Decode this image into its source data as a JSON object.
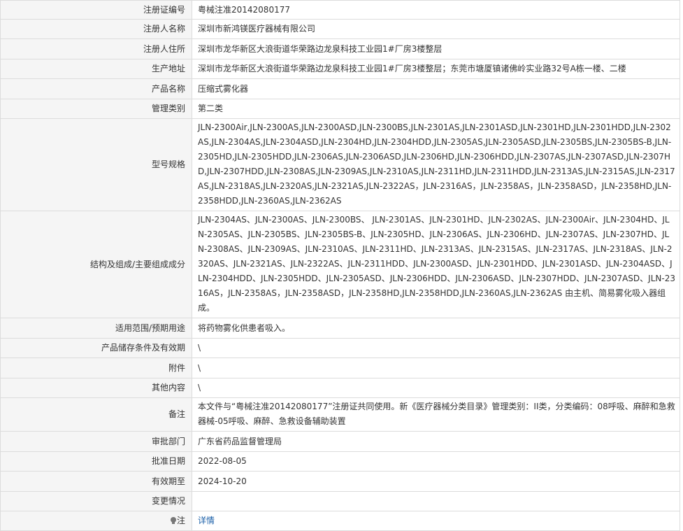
{
  "rows": [
    {
      "label": "注册证编号",
      "value": "粤械注准20142080177"
    },
    {
      "label": "注册人名称",
      "value": "深圳市新鸿镁医疗器械有限公司"
    },
    {
      "label": "注册人住所",
      "value": "深圳市龙华新区大浪街道华荣路边龙泉科技工业园1#厂房3楼整层"
    },
    {
      "label": "生产地址",
      "value": "深圳市龙华新区大浪街道华荣路边龙泉科技工业园1#厂房3楼整层；东莞市塘厦镇诸佛岭实业路32号A栋一楼、二楼"
    },
    {
      "label": "产品名称",
      "value": "压缩式雾化器"
    },
    {
      "label": "管理类别",
      "value": "第二类"
    },
    {
      "label": "型号规格",
      "value": "JLN-2300Air,JLN-2300AS,JLN-2300ASD,JLN-2300BS,JLN-2301AS,JLN-2301ASD,JLN-2301HD,JLN-2301HDD,JLN-2302AS,JLN-2304AS,JLN-2304ASD,JLN-2304HD,JLN-2304HDD,JLN-2305AS,JLN-2305ASD,JLN-2305BS,JLN-2305BS-B,JLN-2305HD,JLN-2305HDD,JLN-2306AS,JLN-2306ASD,JLN-2306HD,JLN-2306HDD,JLN-2307AS,JLN-2307ASD,JLN-2307HD,JLN-2307HDD,JLN-2308AS,JLN-2309AS,JLN-2310AS,JLN-2311HD,JLN-2311HDD,JLN-2313AS,JLN-2315AS,JLN-2317AS,JLN-2318AS,JLN-2320AS,JLN-2321AS,JLN-2322AS，JLN-2316AS，JLN-2358AS，JLN-2358ASD，JLN-2358HD,JLN-2358HDD,JLN-2360AS,JLN-2362AS"
    },
    {
      "label": "结构及组成/主要组成成分",
      "value": "JLN-2304AS、JLN-2300AS、JLN-2300BS、 JLN-2301AS、JLN-2301HD、JLN-2302AS、JLN-2300Air、JLN-2304HD、JLN-2305AS、JLN-2305BS、JLN-2305BS-B、JLN-2305HD、JLN-2306AS、JLN-2306HD、JLN-2307AS、JLN-2307HD、JLN-2308AS、JLN-2309AS、JLN-2310AS、JLN-2311HD、JLN-2313AS、JLN-2315AS、JLN-2317AS、JLN-2318AS、JLN-2320AS、JLN-2321AS、JLN-2322AS、JLN-2311HDD、JLN-2300ASD、JLN-2301HDD、JLN-2301ASD、JLN-2304ASD、JLN-2304HDD、JLN-2305HDD、JLN-2305ASD、JLN-2306HDD、JLN-2306ASD、JLN-2307HDD、JLN-2307ASD、JLN-2316AS，JLN-2358AS，JLN-2358ASD，JLN-2358HD,JLN-2358HDD,JLN-2360AS,JLN-2362AS 由主机、简易雾化吸入器组成。"
    },
    {
      "label": "适用范围/预期用途",
      "value": "将药物雾化供患者吸入。"
    },
    {
      "label": "产品储存条件及有效期",
      "value": "\\"
    },
    {
      "label": "附件",
      "value": "\\"
    },
    {
      "label": "其他内容",
      "value": "\\"
    },
    {
      "label": "备注",
      "value": "本文件与“粤械注准20142080177”注册证共同使用。新《医疗器械分类目录》管理类别：II类，分类编码：08呼吸、麻醉和急救器械-05呼吸、麻醉、急救设备辅助装置"
    },
    {
      "label": "审批部门",
      "value": "广东省药品监督管理局"
    },
    {
      "label": "批准日期",
      "value": "2022-08-05"
    },
    {
      "label": "有效期至",
      "value": "2024-10-20"
    },
    {
      "label": "变更情况",
      "value": ""
    }
  ],
  "note_row": {
    "label": "注",
    "icon": "lightbulb-icon",
    "link_text": "详情"
  }
}
